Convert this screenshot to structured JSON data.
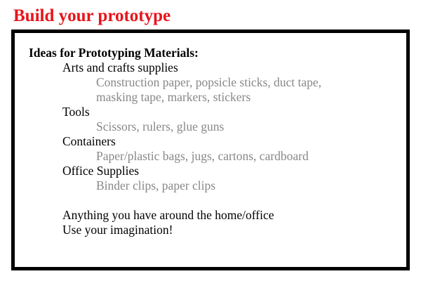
{
  "title": "Build your prototype",
  "colors": {
    "title": "#e8141b",
    "detail": "#888888",
    "border": "#000000"
  },
  "box": {
    "heading": "Ideas for Prototyping Materials:",
    "categories": [
      {
        "name": "Arts and crafts supplies",
        "detail_lines": [
          "Construction paper, popsicle sticks, duct tape,",
          "masking tape, markers, stickers"
        ]
      },
      {
        "name": "Tools",
        "detail_lines": [
          "Scissors, rulers, glue guns"
        ]
      },
      {
        "name": "Containers",
        "detail_lines": [
          "Paper/plastic bags, jugs, cartons, cardboard"
        ]
      },
      {
        "name": "Office Supplies",
        "detail_lines": [
          "Binder clips, paper clips"
        ]
      }
    ],
    "notes": [
      "Anything you have around the home/office",
      "Use your imagination!"
    ]
  }
}
